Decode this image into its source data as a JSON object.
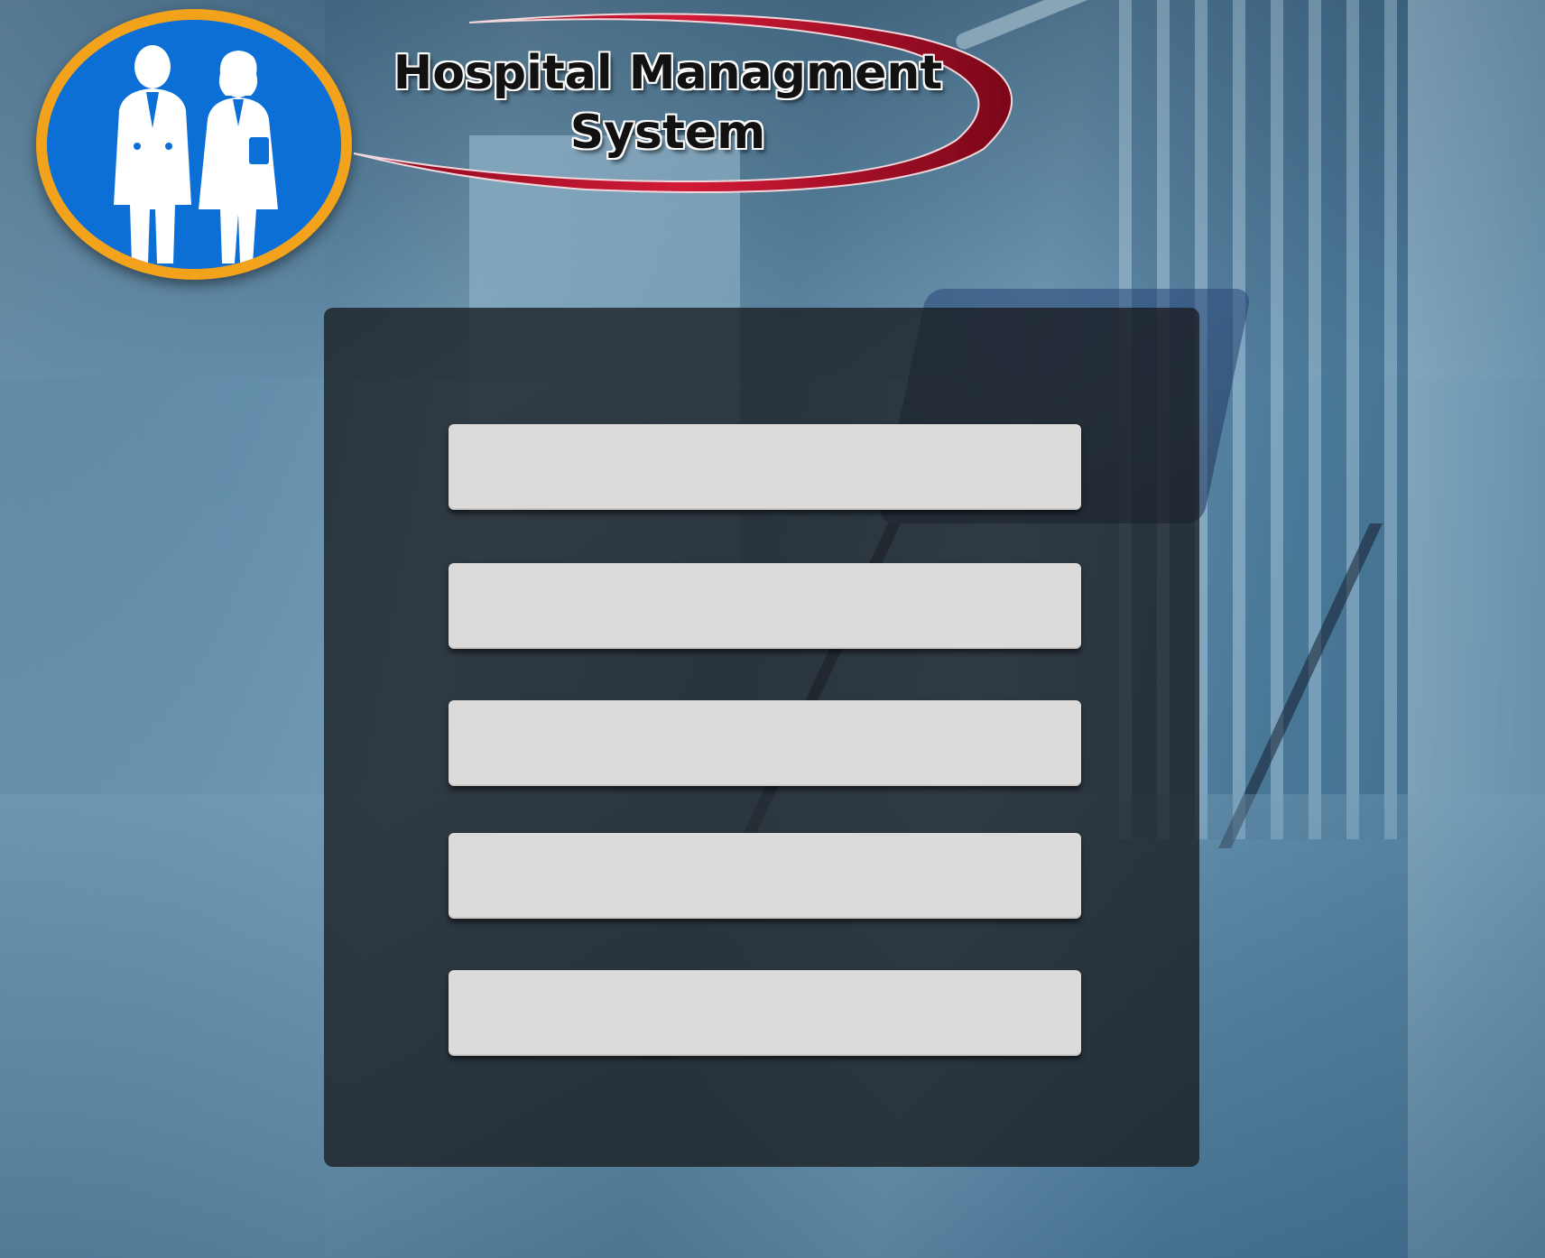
{
  "app": {
    "title_line1": "Hospital Managment",
    "title_line2": "System",
    "title": "Hospital Managment\nSystem"
  },
  "logo": {
    "icon": "doctors-logo-icon",
    "colors": {
      "fill": "#0b6fd6",
      "ring": "#f3a21b",
      "figures": "#ffffff"
    }
  },
  "title_swoosh_color": "#c8102e",
  "menu": {
    "panel_color": "#1a1c20",
    "button_color": "#dcdbda",
    "buttons": [
      {
        "label": ""
      },
      {
        "label": ""
      },
      {
        "label": ""
      },
      {
        "label": ""
      },
      {
        "label": ""
      }
    ]
  }
}
